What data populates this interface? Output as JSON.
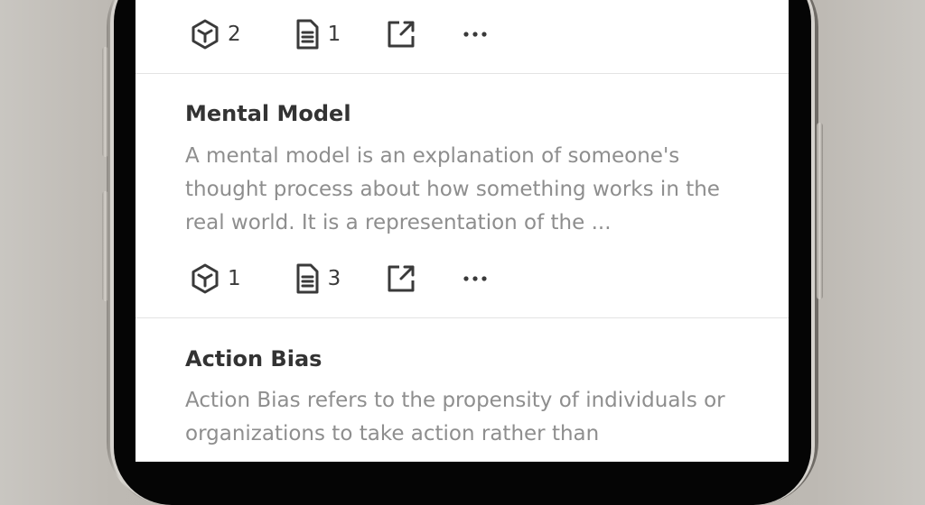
{
  "cards": [
    {
      "title": "",
      "body": "",
      "blocks_count": "2",
      "notes_count": "1"
    },
    {
      "title": "Mental Model",
      "body": "A mental model is an explanation of someone's thought process about how something works in the real world. It is a representation of the ...",
      "blocks_count": "1",
      "notes_count": "3"
    },
    {
      "title": "Action Bias",
      "body": "Action Bias refers to the propensity of individuals or organizations to take action rather than"
    }
  ]
}
